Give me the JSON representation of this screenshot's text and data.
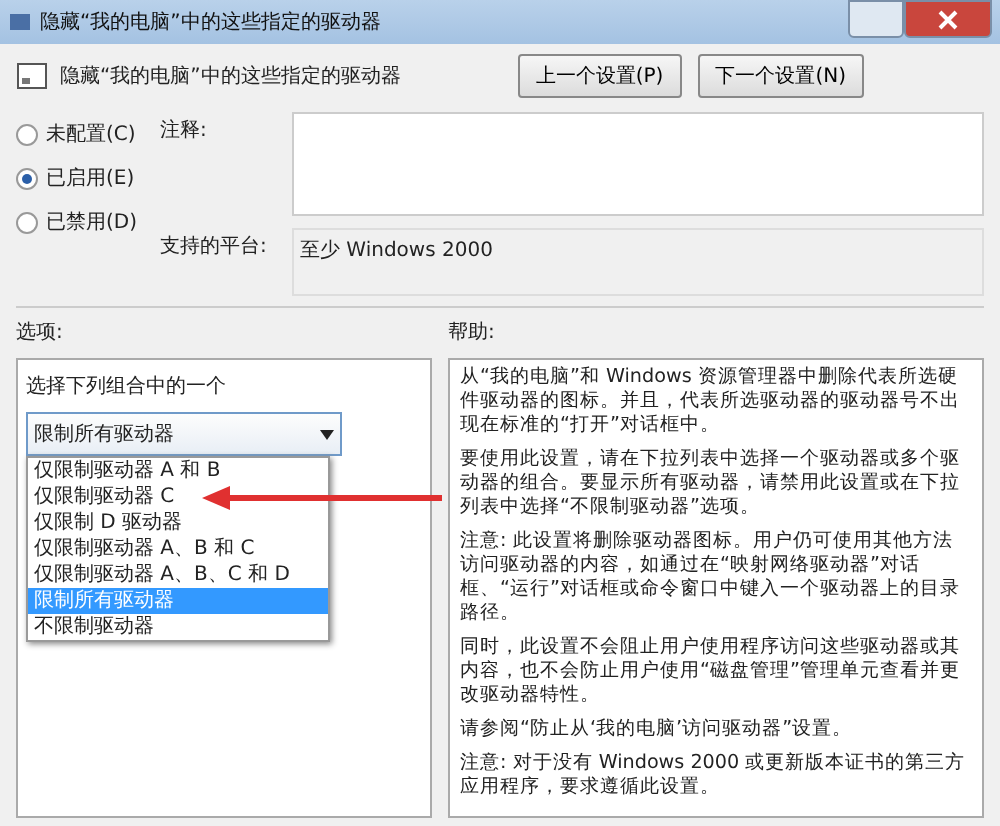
{
  "window": {
    "title": "隐藏“我的电脑”中的这些指定的驱动器"
  },
  "header": {
    "title": "隐藏“我的电脑”中的这些指定的驱动器"
  },
  "nav_buttons": [
    "上一个设置(P)",
    "下一个设置(N)"
  ],
  "radios": [
    {
      "label": "未配置(C)",
      "selected": false
    },
    {
      "label": "已启用(E)",
      "selected": true
    },
    {
      "label": "已禁用(D)",
      "selected": false
    }
  ],
  "comment": {
    "label": "注释:"
  },
  "platform": {
    "label": "支持的平台:",
    "value": "至少 Windows 2000"
  },
  "options": {
    "label": "选项:",
    "prompt": "选择下列组合中的一个",
    "dropdown_value": "限制所有驱动器",
    "dropdown_items": [
      {
        "label": "仅限制驱动器 A 和 B",
        "selected": false
      },
      {
        "label": "仅限制驱动器 C",
        "selected": false
      },
      {
        "label": "仅限制 D 驱动器",
        "selected": false
      },
      {
        "label": "仅限制驱动器 A、B 和 C",
        "selected": false
      },
      {
        "label": "仅限制驱动器 A、B、C 和 D",
        "selected": false
      },
      {
        "label": "限制所有驱动器",
        "selected": true
      },
      {
        "label": "不限制驱动器",
        "selected": false
      }
    ]
  },
  "help": {
    "label": "帮助:",
    "paragraphs": [
      "从“我的电脑”和 Windows 资源管理器中删除代表所选硬件驱动器的图标。并且，代表所选驱动器的驱动器号不出现在标准的“打开”对话框中。",
      "要使用此设置，请在下拉列表中选择一个驱动器或多个驱动器的组合。要显示所有驱动器，请禁用此设置或在下拉列表中选择“不限制驱动器”选项。",
      "注意: 此设置将删除驱动器图标。用户仍可使用其他方法访问驱动器的内容，如通过在“映射网络驱动器”对话框、“运行”对话框或命令窗口中键入一个驱动器上的目录路径。",
      "同时，此设置不会阻止用户使用程序访问这些驱动器或其内容，也不会防止用户使用“磁盘管理”管理单元查看并更改驱动器特性。",
      "请参阅“防止从‘我的电脑’访问驱动器”设置。",
      "注意: 对于没有 Windows 2000 或更新版本证书的第三方应用程序，要求遵循此设置。"
    ]
  }
}
